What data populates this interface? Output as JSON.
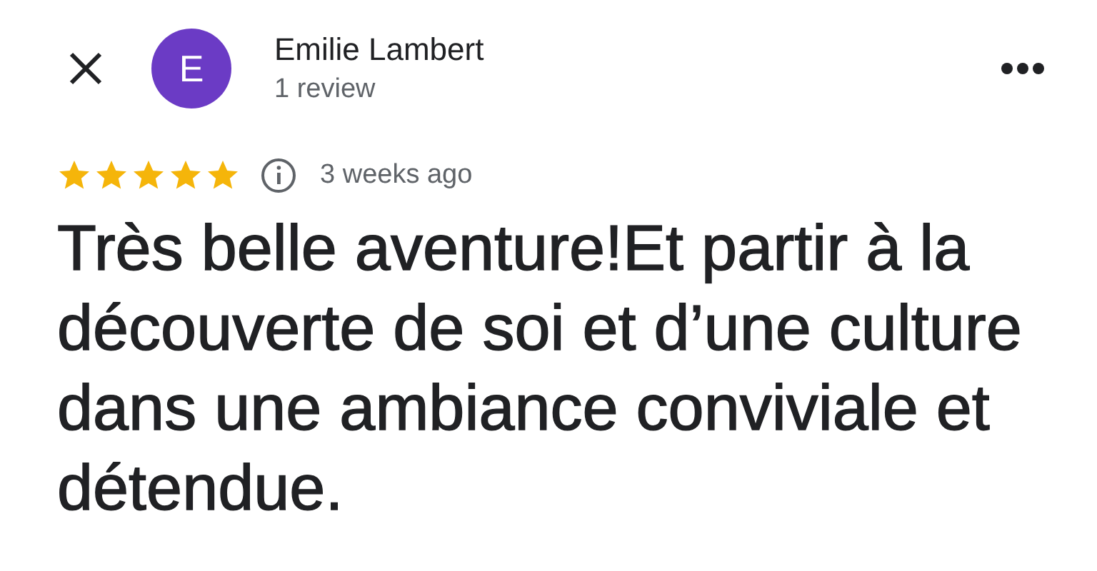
{
  "reviewer": {
    "initial": "E",
    "name": "Emilie Lambert",
    "review_count": "1 review"
  },
  "rating": {
    "stars": 5,
    "time": "3 weeks ago"
  },
  "review_text": "Très belle aventure!Et partir à la découverte de soi et d’une culture dans une ambiance conviviale et détendue."
}
